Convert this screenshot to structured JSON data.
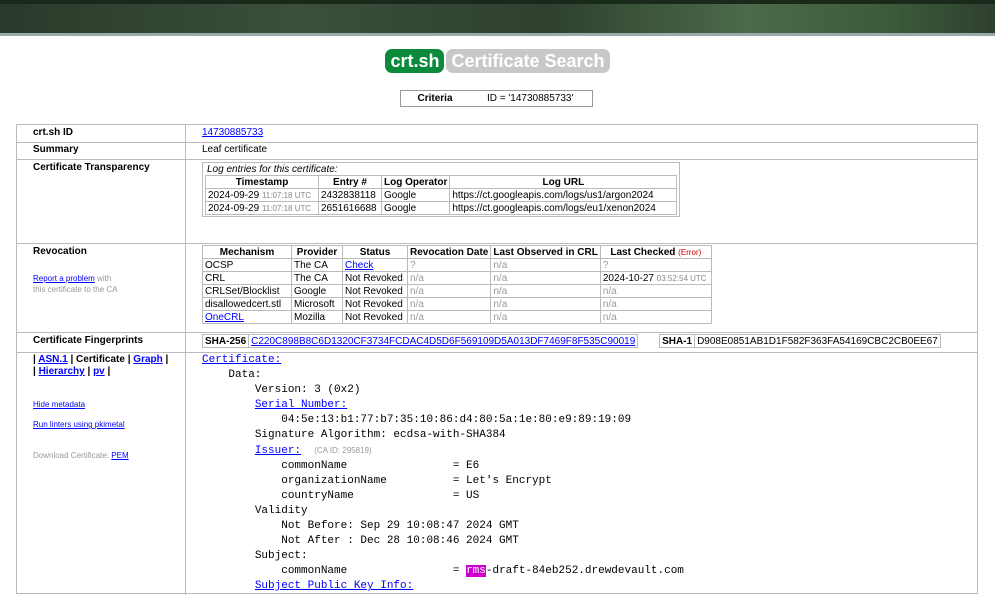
{
  "site": {
    "logo": "crt.sh",
    "subtitle": "Certificate Search"
  },
  "criteria": {
    "label": "Criteria",
    "value": "ID = '14730885733'"
  },
  "rows": {
    "id": {
      "label": "crt.sh ID",
      "value": "14730885733"
    },
    "summary": {
      "label": "Summary",
      "value": "Leaf certificate"
    },
    "ct": {
      "label": "Certificate Transparency",
      "caption": "Log entries for this certificate:",
      "headers": [
        "Timestamp",
        "Entry #",
        "Log Operator",
        "Log URL"
      ],
      "entries": [
        {
          "date": "2024-09-29",
          "time": "11:07:18 UTC",
          "entry": "2432838118",
          "operator": "Google",
          "url": "https://ct.googleapis.com/logs/us1/argon2024"
        },
        {
          "date": "2024-09-29",
          "time": "11:07:18 UTC",
          "entry": "2651616688",
          "operator": "Google",
          "url": "https://ct.googleapis.com/logs/eu1/xenon2024"
        }
      ]
    },
    "revocation": {
      "label": "Revocation",
      "report_link": "Report a problem",
      "report_with": "with",
      "report_tail": "this certificate to the CA",
      "headers": {
        "mechanism": "Mechanism",
        "provider": "Provider",
        "status": "Status",
        "rdate": "Revocation Date",
        "observed": "Last Observed in CRL",
        "checked": "Last Checked",
        "error": "(Error)"
      },
      "rows": [
        {
          "mechanism": "OCSP",
          "provider": "The CA",
          "status": "Check",
          "rdate": "?",
          "observed": "n/a",
          "checked": "?",
          "checked_time": ""
        },
        {
          "mechanism": "CRL",
          "provider": "The CA",
          "status": "Not Revoked",
          "rdate": "n/a",
          "observed": "n/a",
          "checked": "2024-10-27",
          "checked_time": "03:52:54 UTC"
        },
        {
          "mechanism": "CRLSet/Blocklist",
          "provider": "Google",
          "status": "Not Revoked",
          "rdate": "n/a",
          "observed": "n/a",
          "checked": "n/a",
          "checked_time": ""
        },
        {
          "mechanism": "disallowedcert.stl",
          "provider": "Microsoft",
          "status": "Not Revoked",
          "rdate": "n/a",
          "observed": "n/a",
          "checked": "n/a",
          "checked_time": ""
        },
        {
          "mechanism": "OneCRL",
          "provider": "Mozilla",
          "status": "Not Revoked",
          "rdate": "n/a",
          "observed": "n/a",
          "checked": "n/a",
          "checked_time": ""
        }
      ]
    },
    "fingerprints": {
      "label": "Certificate Fingerprints",
      "sha256_label": "SHA-256",
      "sha256": "C220C898B8C6D1320CF3734FCDAC4D5D6F569109D5A013DF7469F8F535C90019",
      "sha1_label": "SHA-1",
      "sha1": "D908E0851AB1D1F582F363FA54169CBC2CB0EE67"
    },
    "cert": {
      "nav1_asn1": "ASN.1",
      "nav1_cert": "Certificate",
      "nav1_graph": "Graph",
      "nav2_hier": "Hierarchy",
      "nav2_pv": "pv",
      "hide_metadata": "Hide metadata",
      "run_linters": "Run linters using pkimetal",
      "download_label": "Download Certificate:",
      "download_pem": "PEM",
      "certificate": "Certificate:",
      "data": "Data:",
      "version": "Version: 3 (0x2)",
      "serial_label": "Serial Number:",
      "serial": "04:5e:13:b1:77:b7:35:10:86:d4:80:5a:1e:80:e9:89:19:09",
      "sigalg": "Signature Algorithm: ecdsa-with-SHA384",
      "issuer_label": "Issuer:",
      "issuer_caid": "(CA ID: 295819)",
      "issuer_cn": "commonName                = E6",
      "issuer_o": "organizationName          = Let's Encrypt",
      "issuer_c": "countryName               = US",
      "validity": "Validity",
      "not_before": "Not Before: Sep 29 10:08:47 2024 GMT",
      "not_after": "Not After : Dec 28 10:08:46 2024 GMT",
      "subject": "Subject:",
      "subject_cn_pre": "commonName                = ",
      "subject_cn_hl": "rms",
      "subject_cn_post": "-draft-84eb252.drewdevault.com",
      "spki": "Subject Public Key Info:"
    }
  },
  "colors": {
    "logo_bg": "#0a8a3a",
    "subtitle_bg": "#c8c8c8",
    "highlight": "#cc00cc",
    "link": "#0000ff"
  }
}
